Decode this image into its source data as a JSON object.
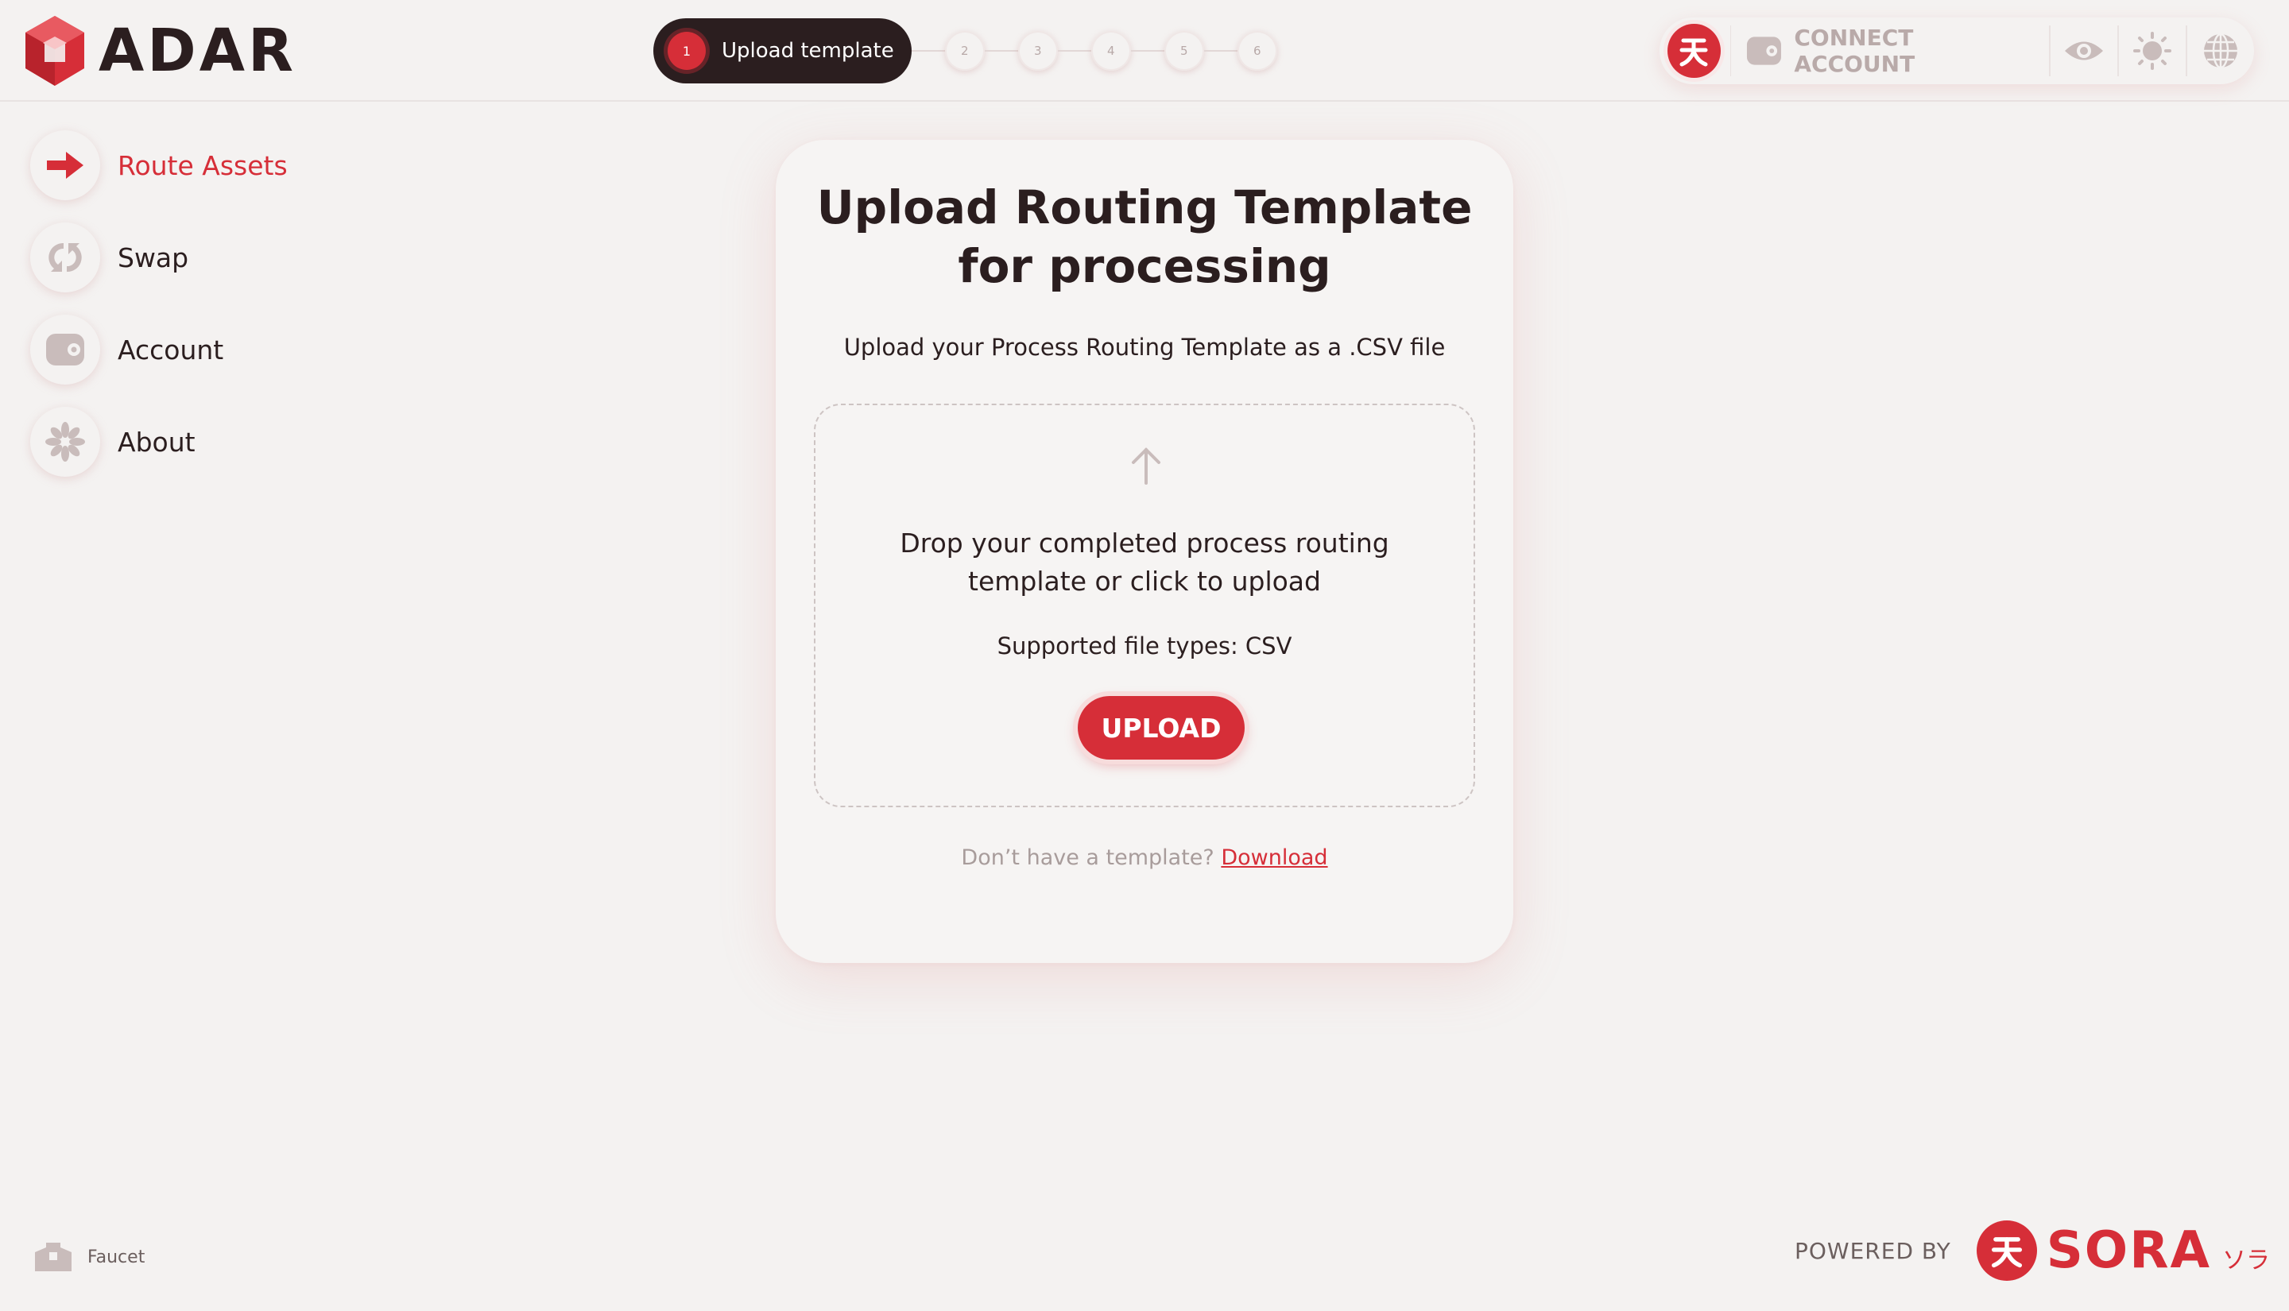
{
  "app": {
    "name": "ADAR"
  },
  "stepper": {
    "active": {
      "number": "1",
      "label": "Upload template"
    },
    "steps": [
      "2",
      "3",
      "4",
      "5",
      "6"
    ]
  },
  "topbar": {
    "connect_label": "CONNECT ACCOUNT"
  },
  "sidebar": {
    "items": [
      {
        "label": "Route Assets",
        "icon": "arrow-right-icon",
        "active": true
      },
      {
        "label": "Swap",
        "icon": "swap-icon"
      },
      {
        "label": "Account",
        "icon": "wallet-icon"
      },
      {
        "label": "About",
        "icon": "flower-icon"
      }
    ]
  },
  "card": {
    "title": "Upload Routing Template for processing",
    "subtitle": "Upload your Process Routing Template as a .CSV file",
    "dropzone": {
      "text": "Drop your completed process routing template or click to upload",
      "supported": "Supported file types: CSV",
      "button": "UPLOAD"
    },
    "footer_text": "Don’t have a template?",
    "footer_link": "Download"
  },
  "footer": {
    "faucet_label": "Faucet",
    "powered_by": "POWERED BY",
    "sora_name": "SORA",
    "sora_kana": "ソラ"
  },
  "colors": {
    "accent": "#d62e38",
    "dark": "#2b1e1f",
    "background": "#f4f2f1"
  }
}
